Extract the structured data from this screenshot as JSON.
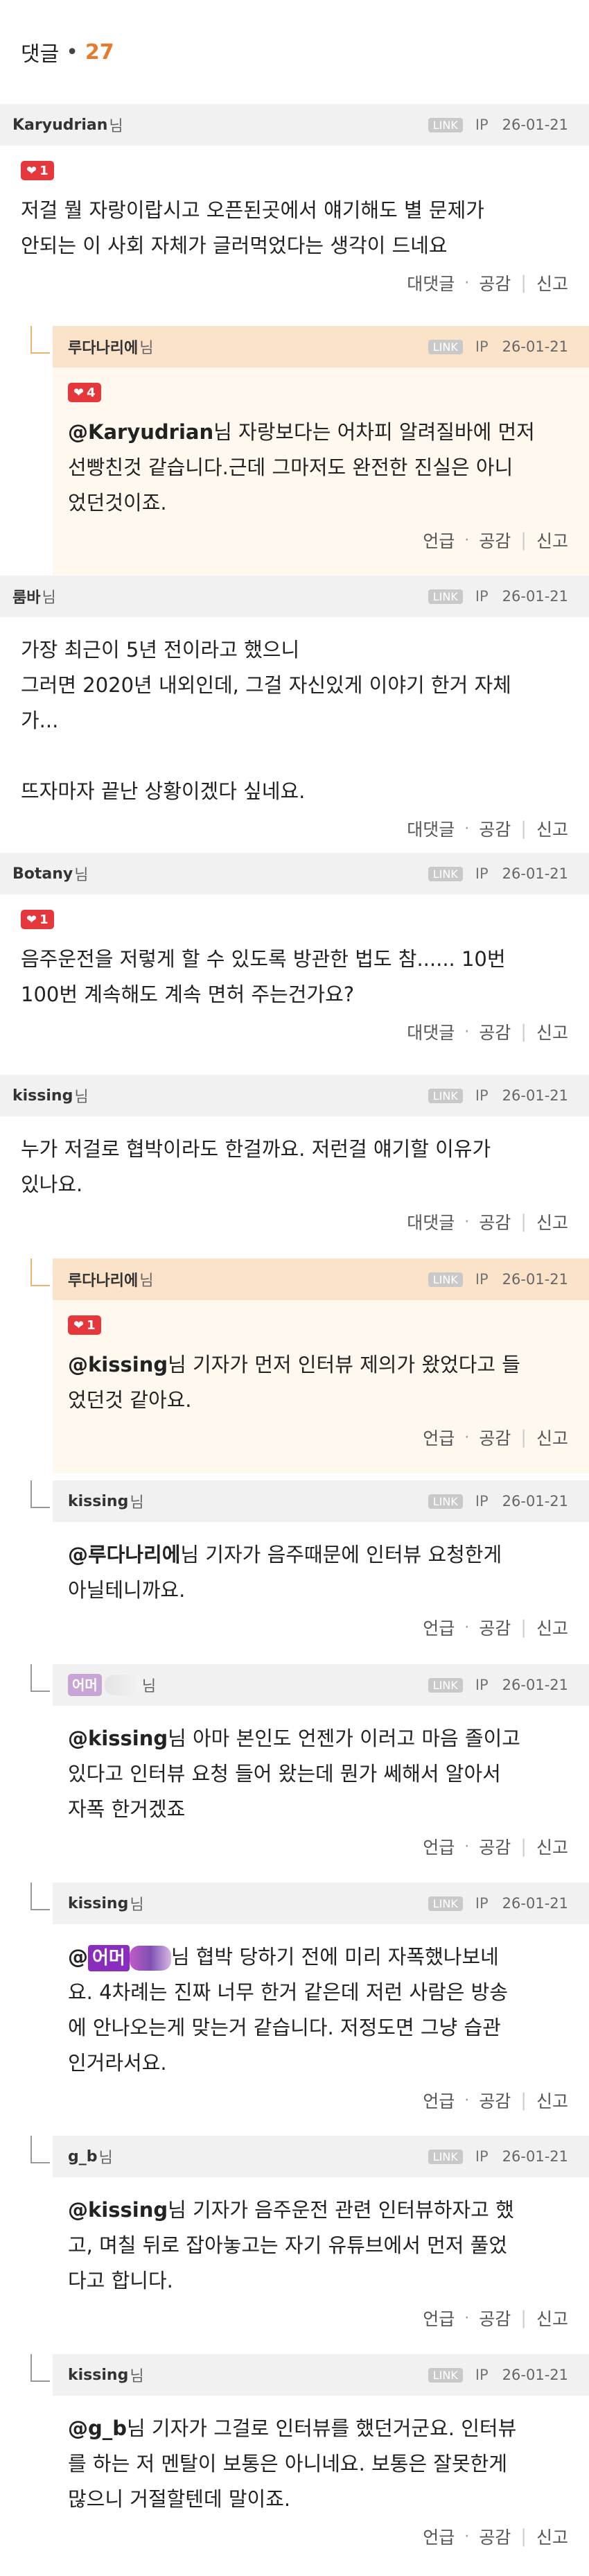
{
  "header": {
    "label": "댓글",
    "dot": "•",
    "count": "27"
  },
  "labels": {
    "nim": "님",
    "link": "LINK",
    "ip": "IP",
    "reply": "대댓글",
    "mention_action": "언급",
    "agree": "공감",
    "report": "신고",
    "dot_sep": "·",
    "bar": "|"
  },
  "colors": {
    "accent": "#e87a2c",
    "like": "#e5383d",
    "author_head": "#fbe3c9",
    "author_body": "#fff8ef",
    "blur_purple": "#8a2dbf"
  },
  "comments": [
    {
      "nick": "Karyudrian",
      "date": "26-01-21",
      "likes": "1",
      "text": "저걸 뭘 자랑이랍시고 오픈된곳에서 얘기해도 별 문제가\n안되는 이 사회 자체가 글러먹었다는 생각이 드네요"
    },
    {
      "nick": "루다나리에",
      "date": "26-01-21",
      "likes": "4",
      "mention": "@Karyudrian",
      "text": "님 자랑보다는 어차피 알려질바에 먼저\n선빵친것 같습니다.근데 그마저도 완전한 진실은 아니\n었던것이죠."
    },
    {
      "nick": "룸바",
      "date": "26-01-21",
      "text": "가장 최근이 5년 전이라고 했으니\n그러면 2020년 내외인데, 그걸 자신있게 이야기 한거 자체\n가...\n\n뜨자마자 끝난 상황이겠다 싶네요."
    },
    {
      "nick": "Botany",
      "date": "26-01-21",
      "likes": "1",
      "text": "음주운전을 저렇게 할 수 있도록 방관한 법도 참...... 10번\n100번 계속해도 계속 면허 주는건가요?"
    },
    {
      "nick": "kissing",
      "date": "26-01-21",
      "text": "누가 저걸로 협박이라도 한걸까요. 저런걸 얘기할 이유가\n있나요."
    },
    {
      "nick": "루다나리에",
      "date": "26-01-21",
      "likes": "1",
      "mention": "@kissing",
      "text": "님 기자가 먼저 인터뷰 제의가 왔었다고 들\n었던것 같아요."
    },
    {
      "nick": "kissing",
      "date": "26-01-21",
      "mention": "@루다나리에",
      "text": "님 기자가 음주때문에 인터뷰 요청한게\n아닐테니까요."
    },
    {
      "nick": "어머",
      "date": "26-01-21",
      "mention": "@kissing",
      "text": "님 아마 본인도 언젠가 이러고 마음 졸이고\n있다고 인터뷰 요청 들어 왔는데 뭔가 쎄해서 알아서\n자폭 한거겠죠"
    },
    {
      "nick": "kissing",
      "date": "26-01-21",
      "mention": "@",
      "blur_mention": "어머",
      "text": "님 협박 당하기 전에 미리 자폭했나보네\n요. 4차례는 진짜 너무 한거 같은데 저런 사람은 방송\n에 안나오는게 맞는거 같습니다. 저정도면 그냥 습관\n인거라서요."
    },
    {
      "nick": "g_b",
      "date": "26-01-21",
      "mention": "@kissing",
      "text": "님 기자가 음주운전 관련 인터뷰하자고 했\n고, 며칠 뒤로 잡아놓고는 자기 유튜브에서 먼저 풀었\n다고 합니다."
    },
    {
      "nick": "kissing",
      "date": "26-01-21",
      "mention": "@g_b",
      "text": "님 기자가 그걸로 인터뷰를 했던거군요. 인터뷰\n를 하는 저 멘탈이 보통은 아니네요. 보통은 잘못한게\n많으니 거절할텐데 말이죠."
    }
  ]
}
